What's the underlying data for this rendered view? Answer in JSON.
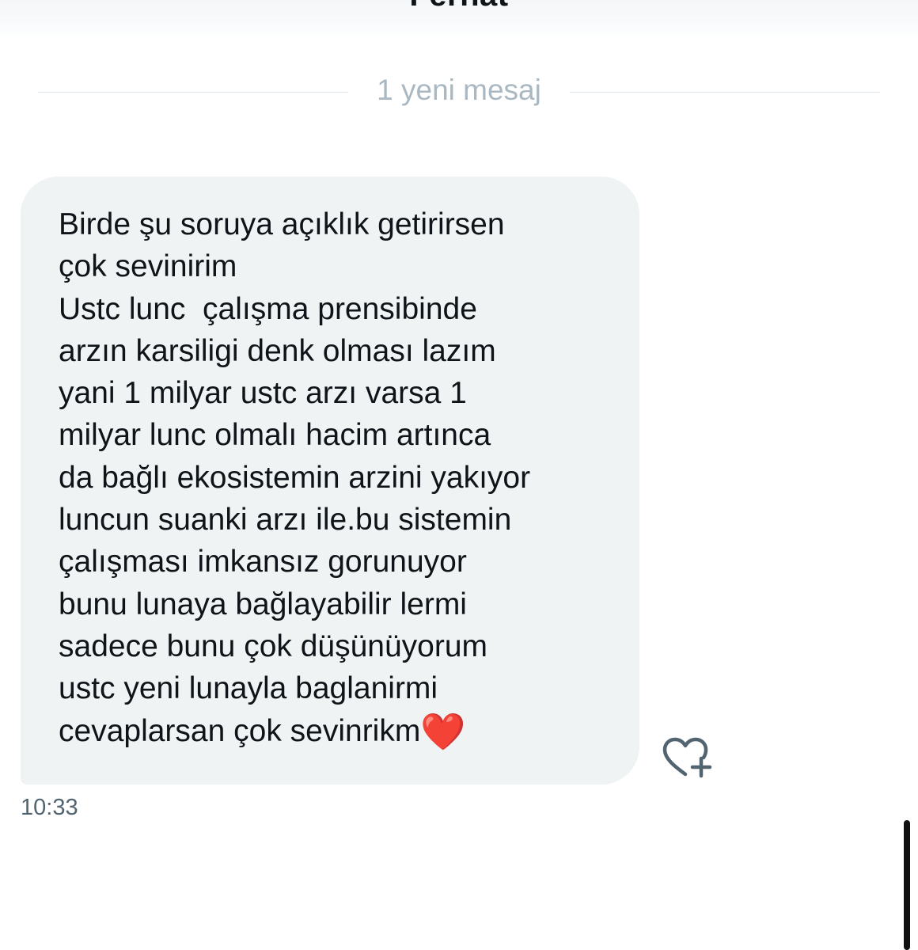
{
  "header": {
    "contact_name": "Ferhat"
  },
  "divider": {
    "label": "1 yeni mesaj"
  },
  "message": {
    "lines": [
      "Birde şu soruya açıklık getirirsen",
      "çok sevinirim",
      "Ustc lunc  çalışma prensibinde",
      "arzın karsiligi denk olması lazım",
      "yani 1 milyar ustc arzı varsa 1",
      "milyar lunc olmalı hacim artınca",
      "da bağlı ekosistemin arzini yakıyor",
      "luncun suanki arzı ile.bu sistemin",
      "çalışması imkansız gorunuyor",
      "bunu lunaya bağlayabilir lermi",
      "sadece bunu çok düşünüyorum",
      "ustc yeni lunayla baglanirmi",
      "cevaplarsan çok sevinrikm"
    ],
    "emoji": "❤️",
    "timestamp": "10:33"
  },
  "icons": {
    "react": "heart-plus-icon"
  },
  "colors": {
    "bubble_bg": "#eff3f4",
    "text": "#0f1419",
    "muted": "#536471",
    "divider_text": "#aab8c2",
    "heart": "#e0141e"
  }
}
